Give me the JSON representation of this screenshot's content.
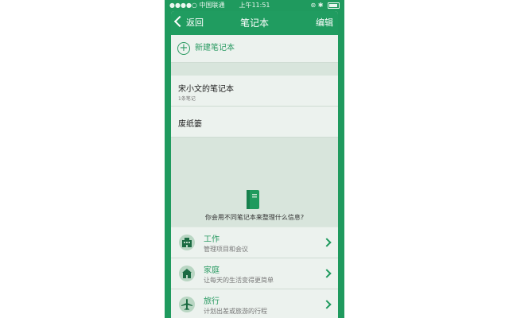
{
  "status_bar": {
    "carrier": "●●●●○ 中国联通",
    "time": "上午11:51",
    "right_icons": "⊛ ✱"
  },
  "nav": {
    "back_label": "返回",
    "title": "笔记本",
    "edit_label": "编辑"
  },
  "new_notebook": {
    "label": "新建笔记本",
    "icon": "plus-circle-icon"
  },
  "notebooks": [
    {
      "title": "宋小文的笔记本",
      "subtitle": "1条笔记"
    },
    {
      "title": "废纸篓",
      "subtitle": ""
    }
  ],
  "empty_prompt": "你会用不同笔记本来整理什么信息?",
  "suggestions": [
    {
      "title": "工作",
      "subtitle": "管理项目和会议",
      "icon": "building-icon"
    },
    {
      "title": "家庭",
      "subtitle": "让每天的生活变得更简单",
      "icon": "house-icon"
    },
    {
      "title": "旅行",
      "subtitle": "计划出差或旅游的行程",
      "icon": "airplane-icon"
    }
  ],
  "colors": {
    "brand_green": "#1f9a5e",
    "row_background": "#ecf2ee",
    "section_background": "#d8e5dc",
    "accent_text": "#2a9a62"
  }
}
